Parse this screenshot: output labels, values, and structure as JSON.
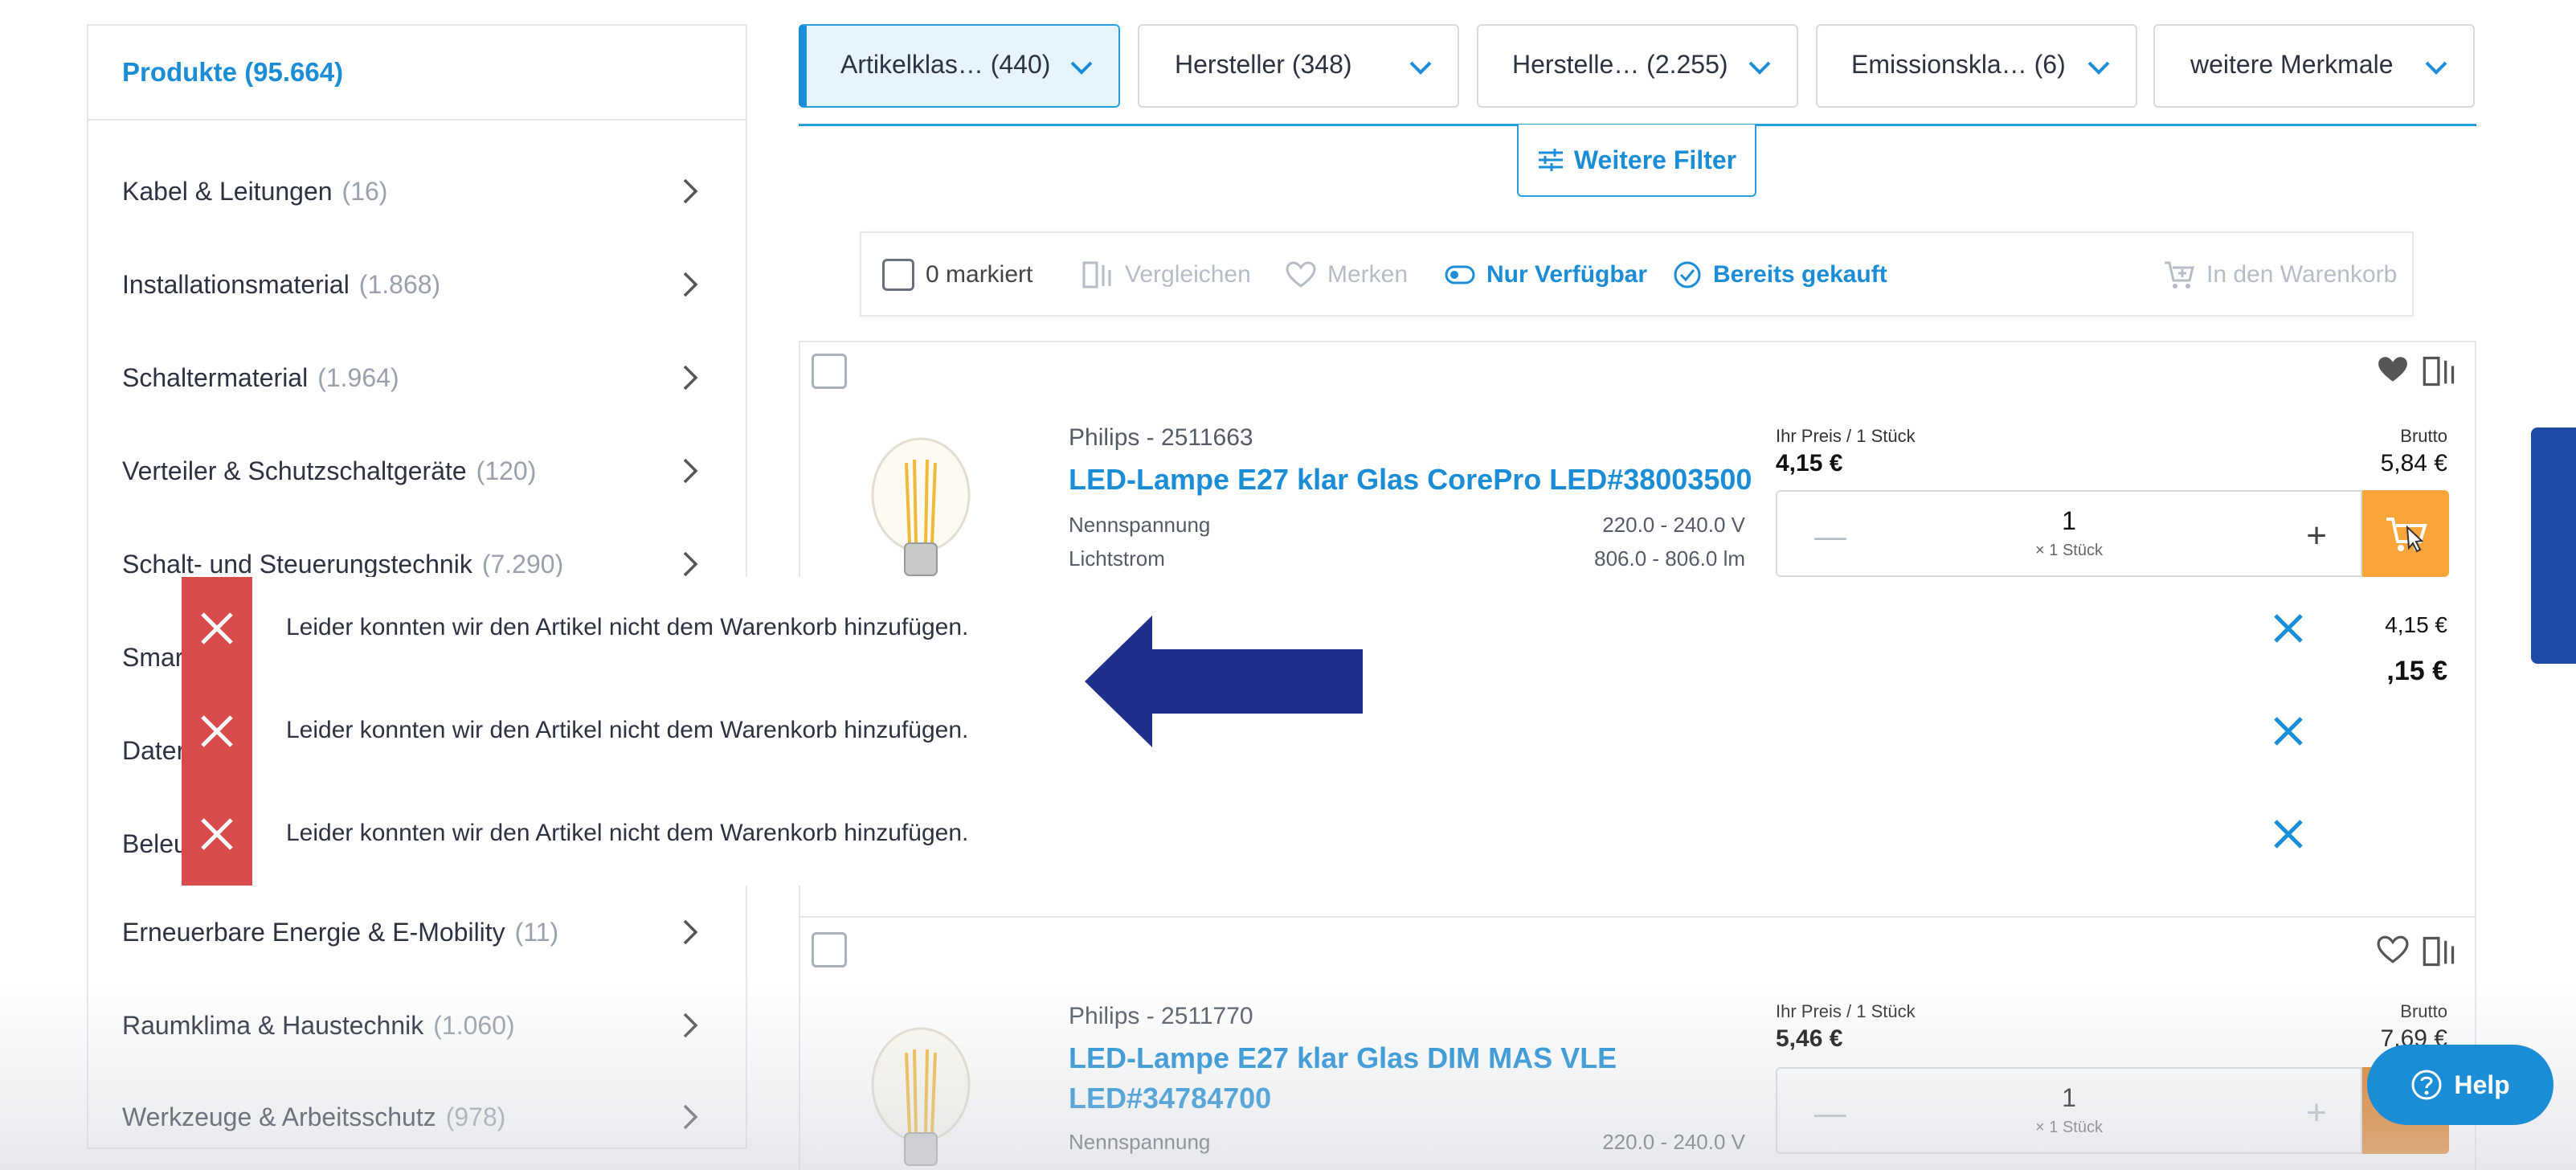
{
  "sidebar": {
    "header": "Produkte (95.664)",
    "categories": [
      {
        "label": "Kabel & Leitungen",
        "count": "(16)"
      },
      {
        "label": "Installationsmaterial",
        "count": "(1.868)"
      },
      {
        "label": "Schaltermaterial",
        "count": "(1.964)"
      },
      {
        "label": "Verteiler & Schutzschaltgeräte",
        "count": "(120)"
      },
      {
        "label": "Schalt- und Steuerungstechnik",
        "count": "(7.290)"
      },
      {
        "label": "Smar",
        "count": ""
      },
      {
        "label": "Dater",
        "count": ""
      },
      {
        "label": "Beleu",
        "count": ""
      },
      {
        "label": "Erneuerbare Energie & E-Mobility",
        "count": "(11)"
      },
      {
        "label": "Raumklima & Haustechnik",
        "count": "(1.060)"
      },
      {
        "label": "Werkzeuge & Arbeitsschutz",
        "count": "(978)"
      }
    ]
  },
  "filters": [
    {
      "label": "Artikelklas… (440)"
    },
    {
      "label": "Hersteller (348)"
    },
    {
      "label": "Herstelle… (2.255)"
    },
    {
      "label": "Emissionskla… (6)"
    },
    {
      "label": "weitere Merkmale"
    }
  ],
  "more_filter": {
    "label": "Weitere Filter"
  },
  "action_bar": {
    "marked": "0 markiert",
    "compare": "Vergleichen",
    "remember": "Merken",
    "only_available": "Nur Verfügbar",
    "already_bought": "Bereits gekauft",
    "add_to_cart": "In den Warenkorb"
  },
  "products": [
    {
      "brand": "Philips - 2511663",
      "title": "LED-Lampe E27 klar Glas CorePro LED#38003500",
      "spec1_label": "Nennspannung",
      "spec1_value": "220.0 - 240.0 V",
      "spec2_label": "Lichtstrom",
      "spec2_value": "806.0 - 806.0 lm",
      "price_label": "Ihr Preis / 1 Stück",
      "price": "4,15 €",
      "brutto_label": "Brutto",
      "brutto": "5,84 €",
      "qty": "1",
      "unit": "× 1 Stück",
      "extra_price": "4,15 €",
      "extra_price_big": ",15 €"
    },
    {
      "brand": "Philips - 2511770",
      "title": "LED-Lampe E27 klar Glas DIM MAS VLE LED#34784700",
      "spec1_label": "Nennspannung",
      "spec1_value": "220.0 - 240.0 V",
      "price_label": "Ihr Preis / 1 Stück",
      "price": "5,46 €",
      "brutto_label": "Brutto",
      "brutto": "7,69 €",
      "qty": "1",
      "unit": "× 1 Stück"
    }
  ],
  "toasts": [
    {
      "message": "Leider konnten wir den Artikel nicht dem Warenkorb hinzufügen."
    },
    {
      "message": "Leider konnten wir den Artikel nicht dem Warenkorb hinzufügen."
    },
    {
      "message": "Leider konnten wir den Artikel nicht dem Warenkorb hinzufügen."
    }
  ],
  "help": {
    "label": "Help"
  },
  "colors": {
    "accent": "#1b8dd6",
    "error": "#d94b4b",
    "cart": "#f7a43b",
    "arrow": "#1f2f8a"
  }
}
